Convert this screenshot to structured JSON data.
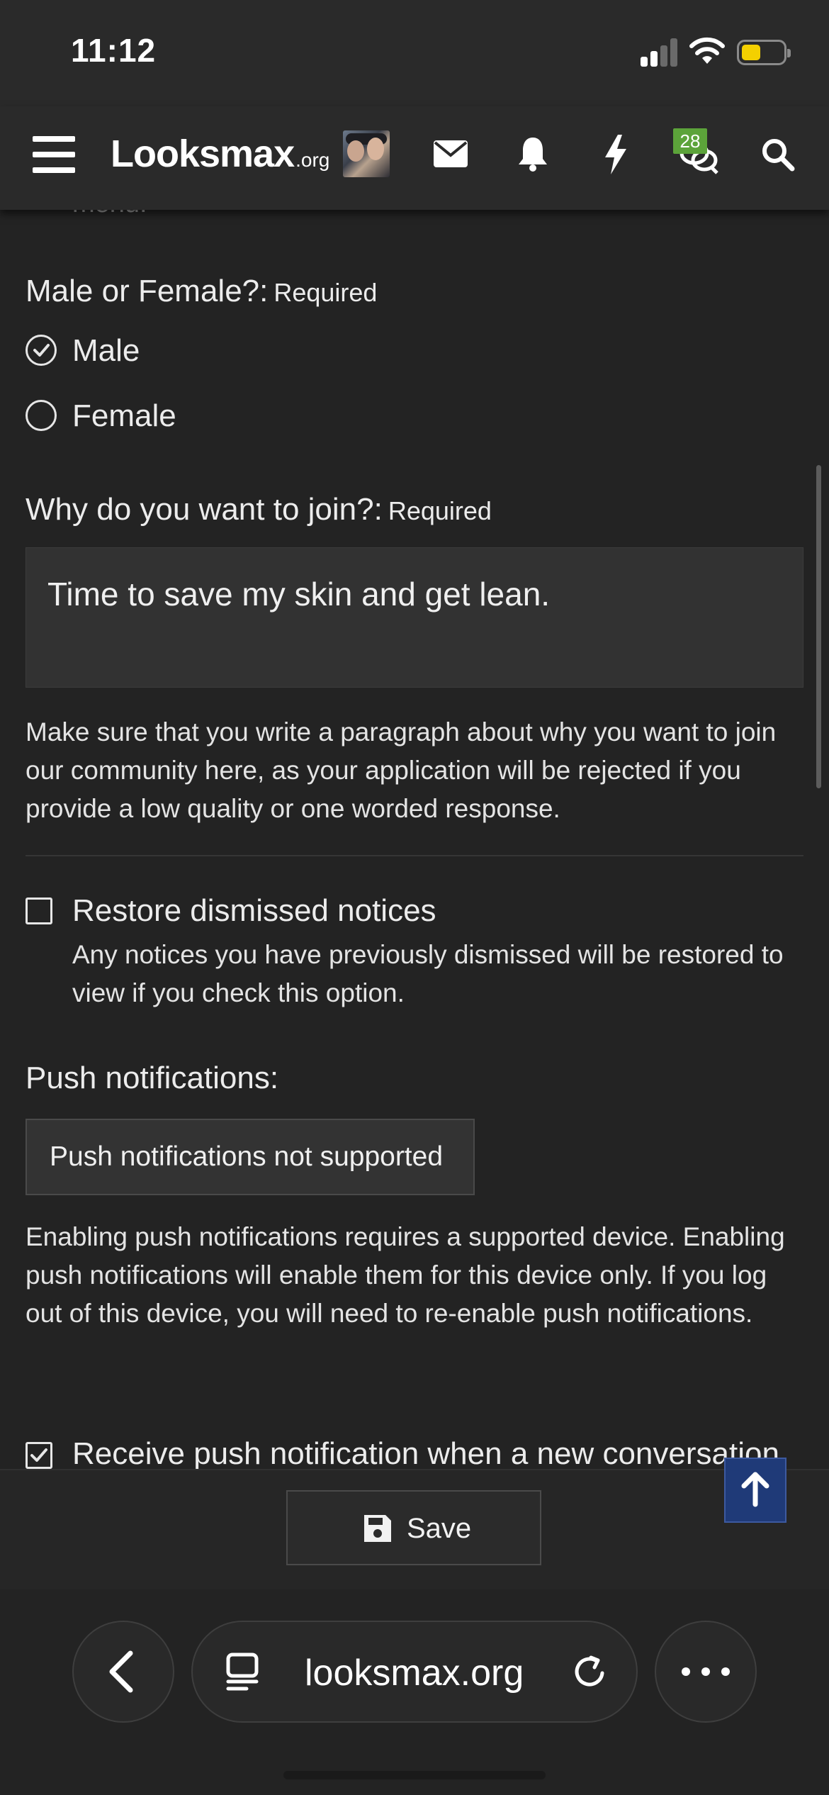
{
  "status_bar": {
    "time": "11:12"
  },
  "header": {
    "logo_main": "Looksmax",
    "logo_suffix": ".org",
    "chat_badge_count": "28",
    "icons": [
      "menu-icon",
      "mail-icon",
      "bell-icon",
      "lightning-icon",
      "chat-icon",
      "search-icon"
    ]
  },
  "form": {
    "cut_text": "menu.",
    "gender": {
      "label": "Male or Female?:",
      "required": "Required",
      "options": [
        {
          "label": "Male",
          "selected": true
        },
        {
          "label": "Female",
          "selected": false
        }
      ]
    },
    "why_join": {
      "label": "Why do you want to join?:",
      "required": "Required",
      "value": "Time to save my skin and get lean.",
      "hint": "Make sure that you write a paragraph about why you want to join our community here, as your application will be rejected if you provide a low quality or one worded response."
    },
    "restore_notices": {
      "label": "Restore dismissed notices",
      "checked": false,
      "hint": "Any notices you have previously dismissed will be restored to view if you check this option."
    },
    "push": {
      "label": "Push notifications:",
      "button": "Push notifications not supported",
      "hint": "Enabling push notifications requires a supported device. Enabling push notifications will enable them for this device only. If you log out of this device, you will need to re-enable push notifications."
    },
    "receive_push": {
      "label": "Receive push notification when a new conversation",
      "checked": true
    }
  },
  "footer": {
    "save_label": "Save"
  },
  "browser": {
    "url": "looksmax.org"
  },
  "colors": {
    "background": "#232323",
    "header": "#2a2a2a",
    "badge": "#5ca33a",
    "scroll_top_button": "#1f3a78",
    "battery": "#f4d000"
  }
}
